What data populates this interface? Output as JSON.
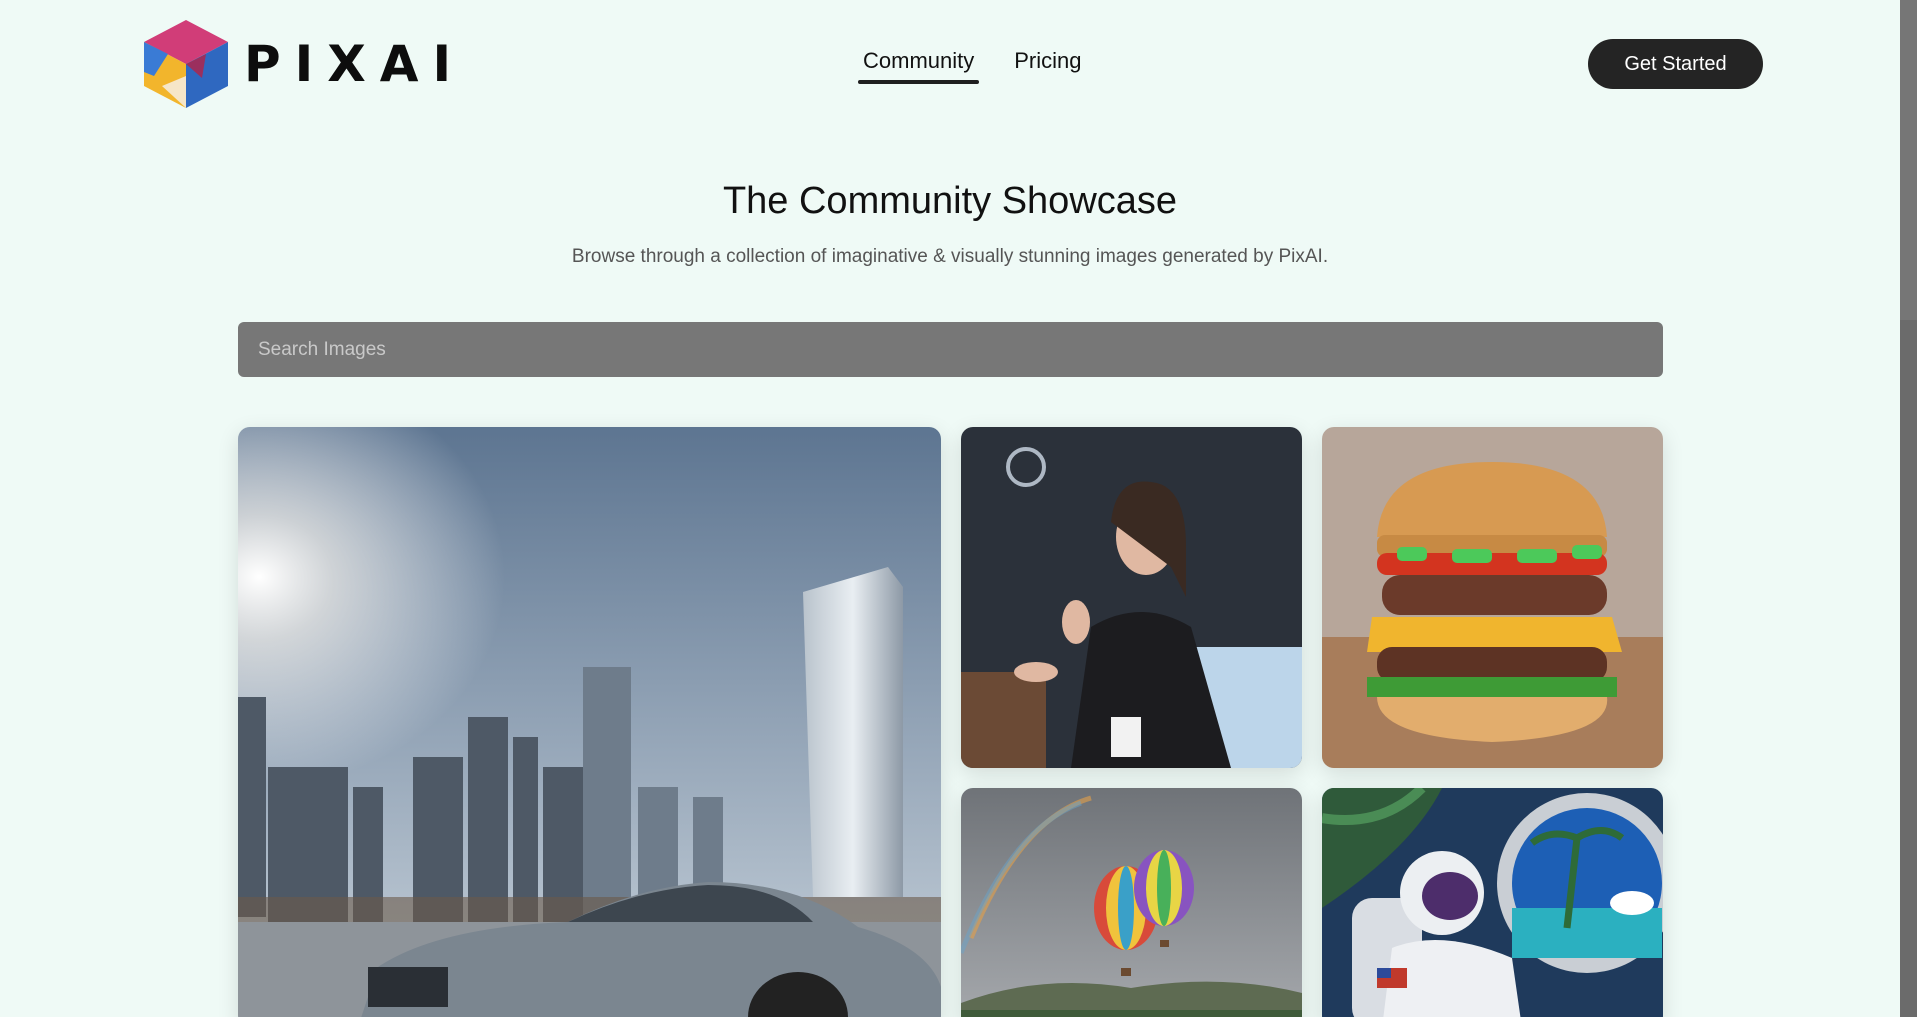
{
  "brand": {
    "name": "PIXAI",
    "logo_icon": "pixai-cube-logo"
  },
  "nav": {
    "items": [
      {
        "label": "Community",
        "active": true
      },
      {
        "label": "Pricing",
        "active": false
      }
    ]
  },
  "header": {
    "cta_label": "Get Started"
  },
  "hero": {
    "title": "The Community Showcase",
    "subtitle": "Browse through a collection of imaginative & visually stunning images generated by PixAI."
  },
  "search": {
    "placeholder": "Search Images",
    "value": ""
  },
  "gallery": {
    "images": [
      {
        "subject": "car-city-skyline"
      },
      {
        "subject": "conference-speaker"
      },
      {
        "subject": "burger"
      },
      {
        "subject": "hot-air-balloons"
      },
      {
        "subject": "astronaut-window"
      }
    ]
  },
  "colors": {
    "background": "#effaf6",
    "button": "#242424",
    "search_bg": "#777777"
  }
}
